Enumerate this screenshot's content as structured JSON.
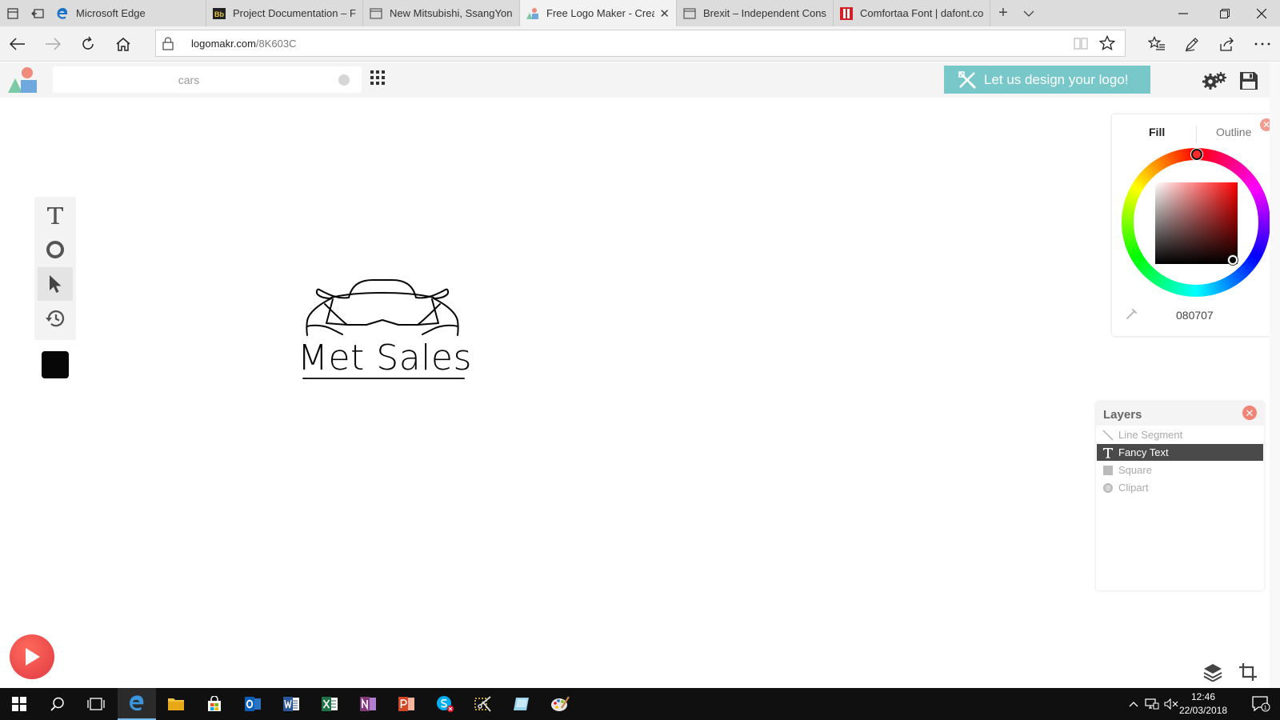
{
  "browser": {
    "tabs": [
      {
        "title": "Microsoft Edge",
        "icon": "edge-icon",
        "active": false
      },
      {
        "title": "Project Documentation – Fc",
        "icon": "blackboard-icon",
        "active": false
      },
      {
        "title": "New Mitsubishi, SsangYong",
        "icon": "page-icon",
        "active": false
      },
      {
        "title": "Free Logo Maker - Crea",
        "icon": "logomakr-icon",
        "active": true
      },
      {
        "title": "Brexit – Independent Consu",
        "icon": "page-icon",
        "active": false
      },
      {
        "title": "Comfortaa Font | dafont.cor",
        "icon": "dafont-icon",
        "active": false
      }
    ],
    "address": {
      "domain": "logomakr.com",
      "path": "/8K603C"
    }
  },
  "site": {
    "search": {
      "placeholder": "cars"
    },
    "cta_label": "Let us design your logo!"
  },
  "canvas": {
    "logo_text": "Met Sales",
    "fill_color": "#080707"
  },
  "color_panel": {
    "tab_fill": "Fill",
    "tab_outline": "Outline",
    "hex": "080707"
  },
  "layers": {
    "title": "Layers",
    "items": [
      {
        "label": "Line Segment",
        "icon": "line-icon",
        "selected": false
      },
      {
        "label": "Fancy Text",
        "icon": "text-icon",
        "selected": true
      },
      {
        "label": "Square",
        "icon": "square-icon",
        "selected": false
      },
      {
        "label": "Clipart",
        "icon": "clipart-icon",
        "selected": false
      }
    ]
  },
  "taskbar": {
    "time": "12:46",
    "date": "22/03/2018",
    "notification_count": "1"
  },
  "colors": {
    "accent_cta": "#79c8c9",
    "play_button": "#e8484a",
    "selected_layer": "#4a4a4a",
    "close_button": "#f08577"
  }
}
